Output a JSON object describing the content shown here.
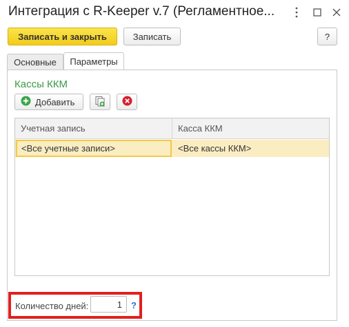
{
  "window": {
    "title": "Интеграция с R-Keeper v.7 (Регламентное..."
  },
  "toolbar": {
    "save_close_label": "Записать и закрыть",
    "save_label": "Записать",
    "help_label": "?"
  },
  "tabs": [
    {
      "label": "Основные",
      "active": false
    },
    {
      "label": "Параметры",
      "active": true
    }
  ],
  "section": {
    "title": "Кассы ККМ",
    "add_label": "Добавить"
  },
  "table": {
    "columns": [
      "Учетная запись",
      "Касса ККМ"
    ],
    "rows": [
      [
        "<Все учетные записи>",
        "<Все кассы ККМ>"
      ]
    ]
  },
  "footer": {
    "days_label": "Количество дней:",
    "days_value": "1",
    "help_label": "?"
  },
  "colors": {
    "primary_button": "#f2cc1b",
    "section_title": "#3b9a47",
    "selected_row": "#fbedc2",
    "highlight_frame": "#e31e1e"
  },
  "icons": [
    "more-icon",
    "maximize-icon",
    "close-icon",
    "add-icon",
    "copy-icon",
    "delete-icon"
  ]
}
